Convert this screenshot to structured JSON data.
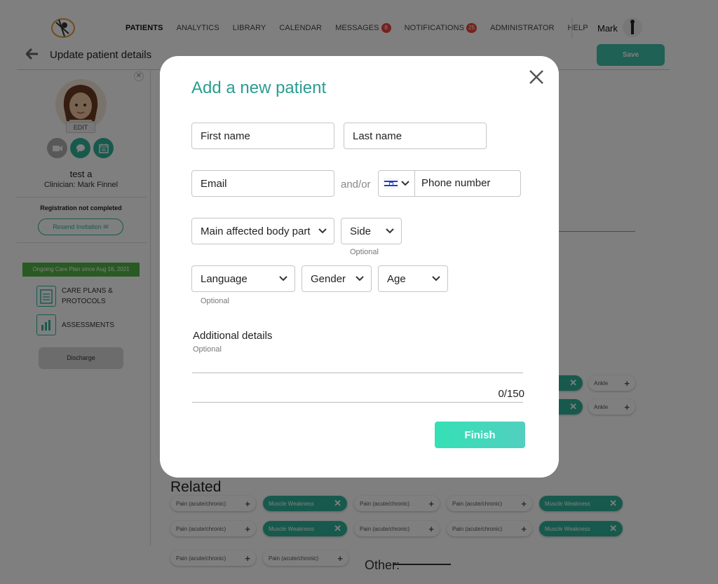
{
  "nav": {
    "items": [
      {
        "label": "PATIENTS",
        "badge": ""
      },
      {
        "label": "ANALYTICS",
        "badge": ""
      },
      {
        "label": "LIBRARY",
        "badge": ""
      },
      {
        "label": "CALENDAR",
        "badge": ""
      },
      {
        "label": "MESSAGES",
        "badge": "8"
      },
      {
        "label": "NOTIFICATIONS",
        "badge": "25"
      },
      {
        "label": "ADMINISTRATOR",
        "badge": ""
      },
      {
        "label": "HELP",
        "badge": ""
      }
    ],
    "user_name": "Mark"
  },
  "subheader": {
    "title": "Update patient details",
    "save_label": "Save"
  },
  "sidebar": {
    "edit_label": "EDIT",
    "patient_name": "test a",
    "clinician": "Clinician: Mark Finnel",
    "registration_status": "Registration not completed",
    "resend_label": "Resend Invitation",
    "care_banner": "Ongoing Care Plan since Aug 16, 2021",
    "menu": [
      {
        "label1": "CARE PLANS &",
        "label2": "PROTOCOLS"
      },
      {
        "label1": "ASSESSMENTS",
        "label2": ""
      }
    ],
    "discharge_label": "Discharge"
  },
  "background": {
    "related_title": "Related",
    "other_label": "Other:",
    "chip_pain": "Pain (acute/chronic)",
    "chip_muscle": "Muscle Weakness",
    "chip_ankle": "Ankle"
  },
  "modal": {
    "title": "Add a new patient",
    "first_name_placeholder": "First name",
    "last_name_placeholder": "Last name",
    "email_placeholder": "Email",
    "and_or": "and/or",
    "phone_placeholder": "Phone number",
    "body_part_label": "Main affected body part",
    "side_label": "Side",
    "side_hint": "Optional",
    "language_label": "Language",
    "language_hint": "Optional",
    "gender_label": "Gender",
    "age_label": "Age",
    "additional_label": "Additional details",
    "additional_hint": "Optional",
    "counter": "0/150",
    "finish_label": "Finish"
  },
  "colors": {
    "accent": "#2fb59a",
    "title_teal": "#2a9d8f",
    "badge_red": "#e8453c",
    "banner_green": "#55b546"
  }
}
